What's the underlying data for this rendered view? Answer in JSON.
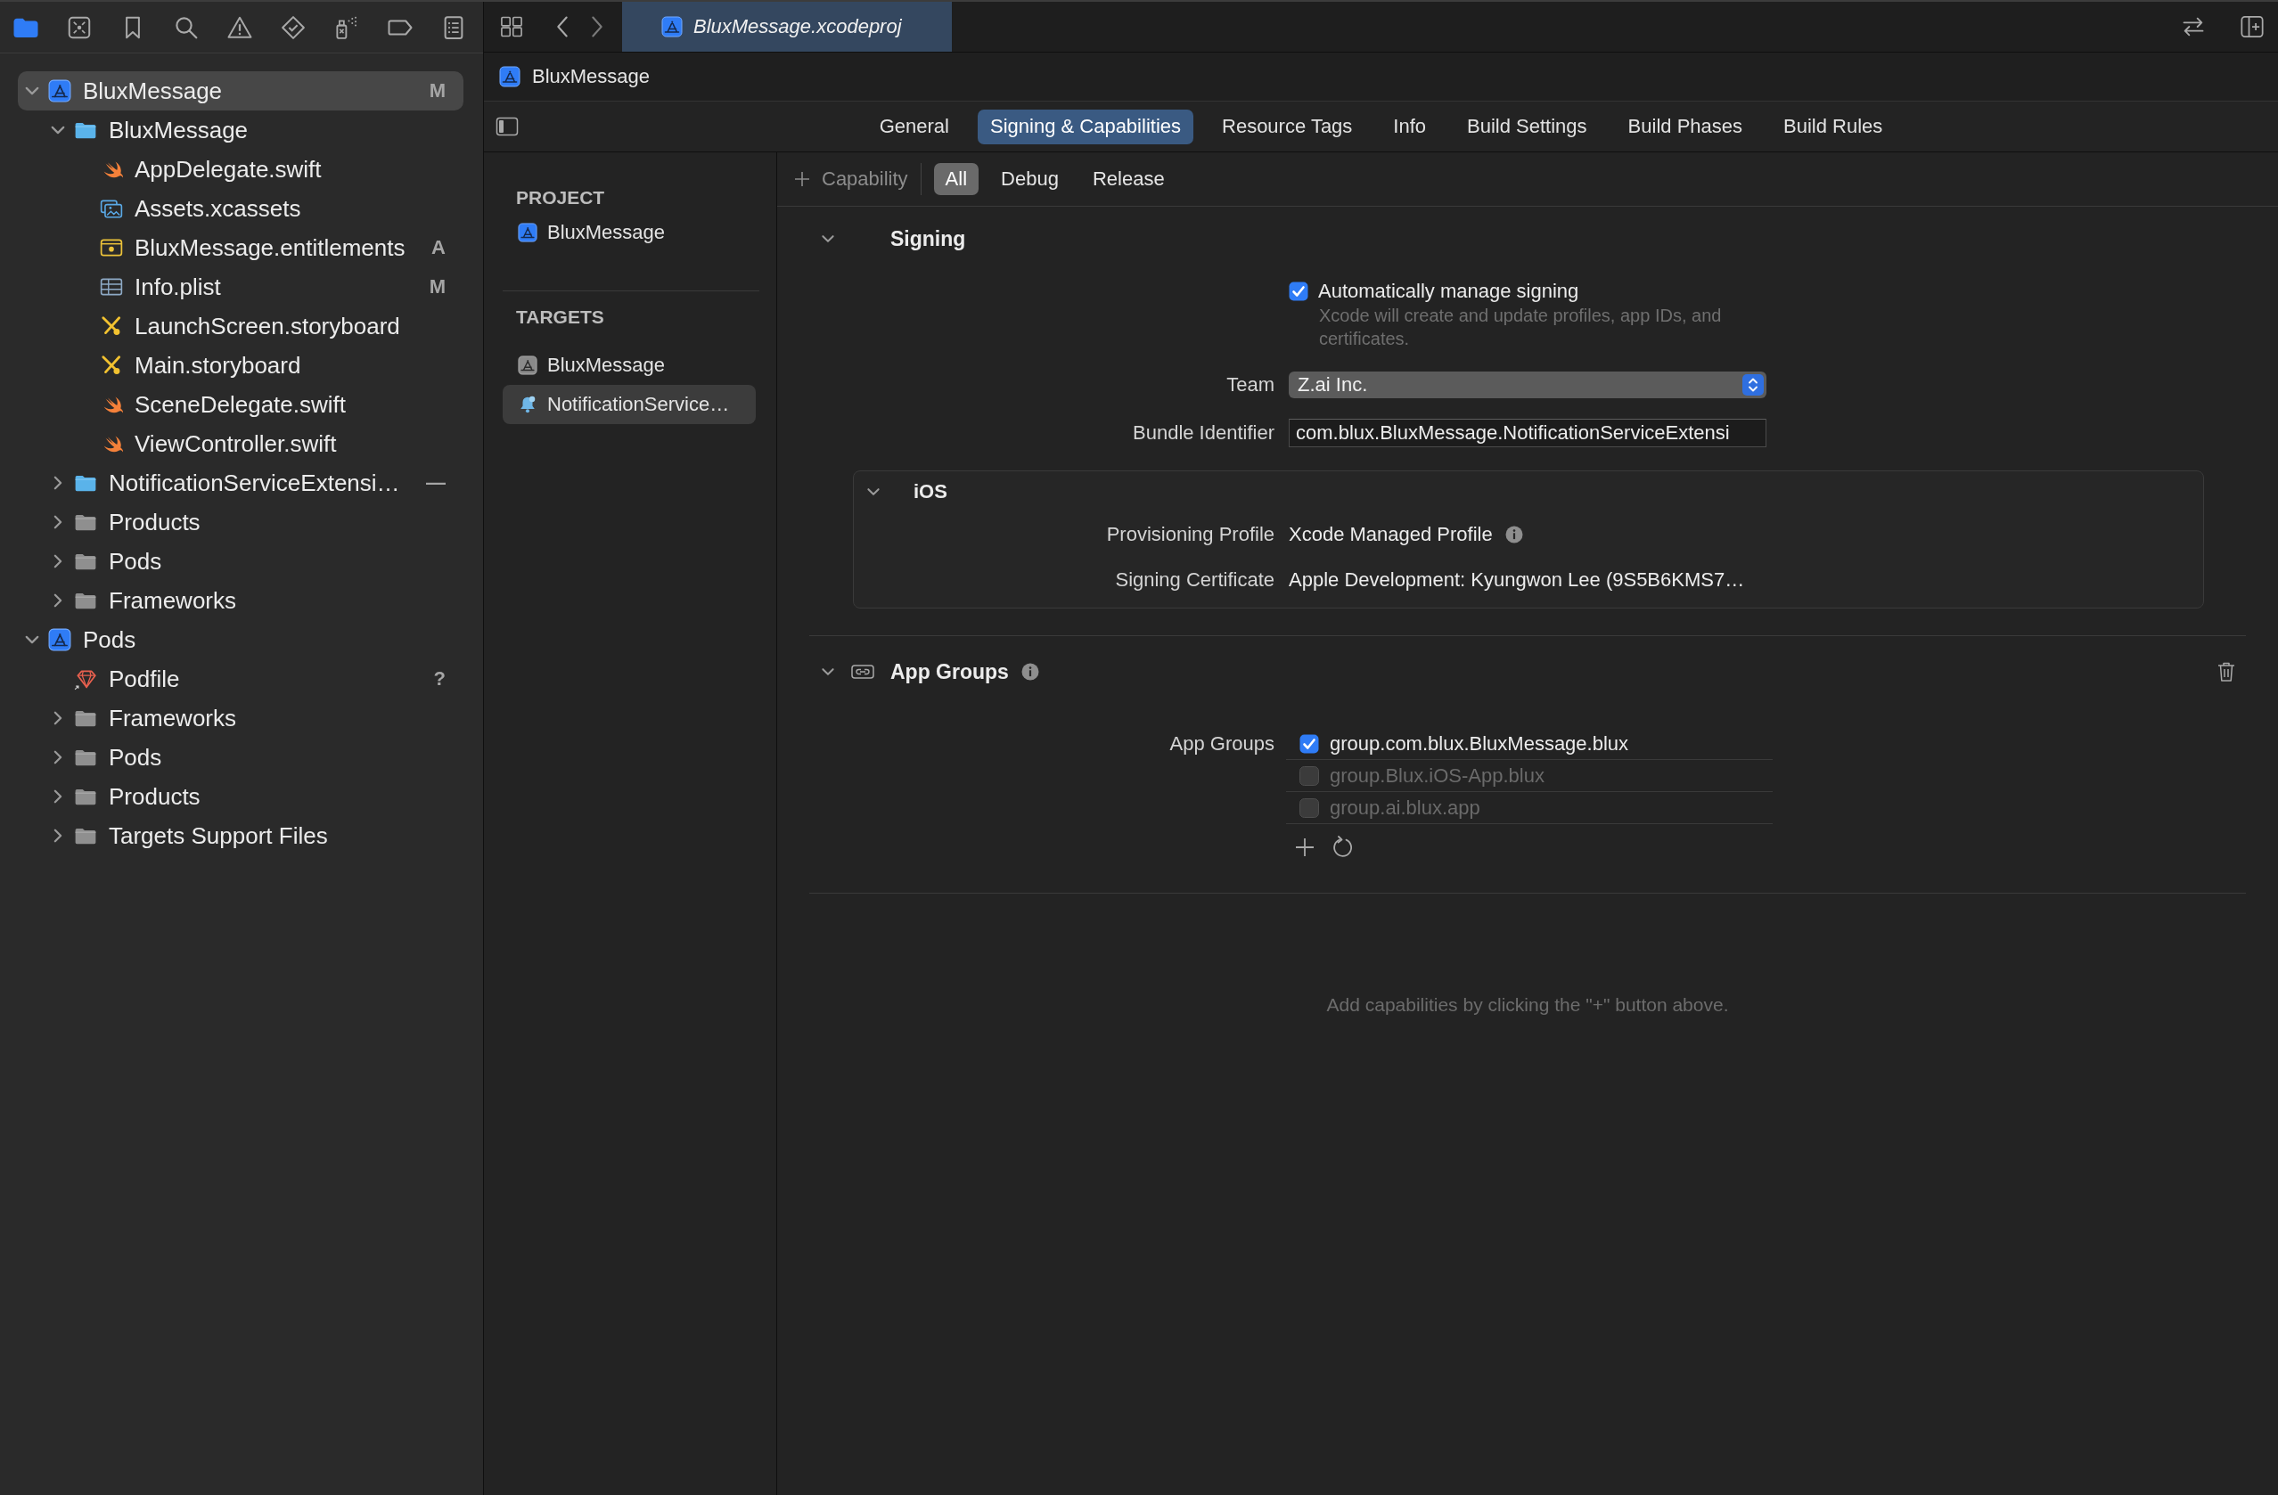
{
  "navigator": {
    "toolbar": [
      {
        "kind": "folder",
        "selected": true
      },
      {
        "kind": "source-control",
        "selected": false
      },
      {
        "kind": "bookmark",
        "selected": false
      },
      {
        "kind": "search",
        "selected": false
      },
      {
        "kind": "issue",
        "selected": false
      },
      {
        "kind": "test",
        "selected": false
      },
      {
        "kind": "debug",
        "selected": false
      },
      {
        "kind": "breakpoint",
        "selected": false
      },
      {
        "kind": "report",
        "selected": false
      }
    ],
    "tree": [
      {
        "name": "BluxMessage",
        "kind": "project",
        "badge": "M",
        "expanded": true,
        "selected": true,
        "children": [
          {
            "name": "BluxMessage",
            "kind": "folder",
            "expanded": true,
            "selected": false,
            "children": [
              {
                "name": "AppDelegate.swift",
                "kind": "swift",
                "selected": false
              },
              {
                "name": "Assets.xcassets",
                "kind": "assets",
                "selected": false
              },
              {
                "name": "BluxMessage.entitlements",
                "kind": "entitlements",
                "badge": "A",
                "selected": false
              },
              {
                "name": "Info.plist",
                "kind": "plist",
                "badge": "M",
                "selected": false
              },
              {
                "name": "LaunchScreen.storyboard",
                "kind": "storyboard",
                "selected": false
              },
              {
                "name": "Main.storyboard",
                "kind": "storyboard",
                "selected": false
              },
              {
                "name": "SceneDelegate.swift",
                "kind": "swift",
                "selected": false
              },
              {
                "name": "ViewController.swift",
                "kind": "swift",
                "selected": false
              }
            ]
          },
          {
            "name": "NotificationServiceExtensi…",
            "kind": "folder",
            "badge": "—",
            "expanded": false,
            "selected": false
          },
          {
            "name": "Products",
            "kind": "group",
            "expanded": false,
            "selected": false
          },
          {
            "name": "Pods",
            "kind": "group",
            "expanded": false,
            "selected": false
          },
          {
            "name": "Frameworks",
            "kind": "group",
            "expanded": false,
            "selected": false
          }
        ]
      },
      {
        "name": "Pods",
        "kind": "project",
        "expanded": true,
        "selected": false,
        "children": [
          {
            "name": "Podfile",
            "kind": "podfile",
            "badge": "?",
            "selected": false
          },
          {
            "name": "Frameworks",
            "kind": "group",
            "expanded": false,
            "selected": false
          },
          {
            "name": "Pods",
            "kind": "group",
            "expanded": false,
            "selected": false
          },
          {
            "name": "Products",
            "kind": "group",
            "expanded": false,
            "selected": false
          },
          {
            "name": "Targets Support Files",
            "kind": "group",
            "expanded": false,
            "selected": false
          }
        ]
      }
    ]
  },
  "editor": {
    "tab_title": "BluxMessage.xcodeproj",
    "breadcrumb": "BluxMessage",
    "tabs": [
      {
        "label": "General",
        "selected": false
      },
      {
        "label": "Signing & Capabilities",
        "selected": true
      },
      {
        "label": "Resource Tags",
        "selected": false
      },
      {
        "label": "Info",
        "selected": false
      },
      {
        "label": "Build Settings",
        "selected": false
      },
      {
        "label": "Build Phases",
        "selected": false
      },
      {
        "label": "Build Rules",
        "selected": false
      }
    ],
    "project_header": "PROJECT",
    "projects": [
      {
        "name": "BluxMessage",
        "selected": false
      }
    ],
    "targets_header": "TARGETS",
    "targets": [
      {
        "name": "BluxMessage",
        "kind": "app",
        "selected": false
      },
      {
        "name": "NotificationService…",
        "kind": "extension",
        "selected": true
      }
    ],
    "capability_button": "Capability",
    "filters": [
      {
        "label": "All",
        "selected": true
      },
      {
        "label": "Debug",
        "selected": false
      },
      {
        "label": "Release",
        "selected": false
      }
    ],
    "signing": {
      "title": "Signing",
      "expanded": true,
      "auto_manage": {
        "label": "Automatically manage signing",
        "checked": true,
        "hint": "Xcode will create and update profiles, app IDs, and certificates."
      },
      "team": {
        "label": "Team",
        "value": "Z.ai Inc."
      },
      "bundle_identifier": {
        "label": "Bundle Identifier",
        "value": "com.blux.BluxMessage.NotificationServiceExtensi"
      },
      "ios": {
        "title": "iOS",
        "expanded": true,
        "provisioning_profile": {
          "label": "Provisioning Profile",
          "value": "Xcode Managed Profile"
        },
        "signing_certificate": {
          "label": "Signing Certificate",
          "value": "Apple Development: Kyungwon Lee (9S5B6KMS7…"
        }
      }
    },
    "app_groups": {
      "title": "App Groups",
      "expanded": true,
      "label": "App Groups",
      "groups": [
        {
          "name": "group.com.blux.BluxMessage.blux",
          "checked": true
        },
        {
          "name": "group.Blux.iOS-App.blux",
          "checked": false
        },
        {
          "name": "group.ai.blux.app",
          "checked": false
        }
      ]
    },
    "empty_hint": "Add capabilities by clicking the \"+\" button above."
  }
}
